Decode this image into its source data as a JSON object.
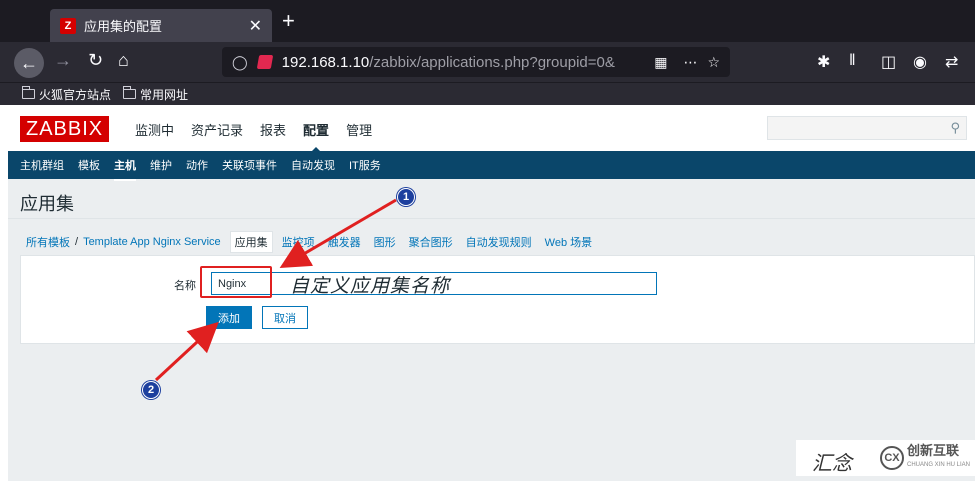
{
  "browser": {
    "tab_favicon": "Z",
    "tab_title": "应用集的配置",
    "tab_close": "✕",
    "new_tab": "+",
    "url_host": "192.168.1.10",
    "url_path": "/zabbix/applications.php?groupid=0&",
    "bookmarks": [
      "火狐官方站点",
      "常用网址"
    ]
  },
  "zabbix": {
    "logo": "ZABBIX",
    "main_menu": [
      {
        "label": "监测中",
        "selected": false
      },
      {
        "label": "资产记录",
        "selected": false
      },
      {
        "label": "报表",
        "selected": false
      },
      {
        "label": "配置",
        "selected": true
      },
      {
        "label": "管理",
        "selected": false
      }
    ],
    "search_placeholder": "",
    "sub_menu": [
      {
        "label": "主机群组",
        "selected": false
      },
      {
        "label": "模板",
        "selected": false
      },
      {
        "label": "主机",
        "selected": true
      },
      {
        "label": "维护",
        "selected": false
      },
      {
        "label": "动作",
        "selected": false
      },
      {
        "label": "关联项事件",
        "selected": false
      },
      {
        "label": "自动发现",
        "selected": false
      },
      {
        "label": "IT服务",
        "selected": false
      }
    ],
    "page_title": "应用集",
    "breadcrumbs": {
      "all_templates": "所有模板",
      "separator": "/",
      "template": "Template App Nginx Service",
      "tabs": [
        "应用集",
        "监控项",
        "触发器",
        "图形",
        "聚合图形",
        "自动发现规则",
        "Web 场景"
      ]
    },
    "form": {
      "name_label": "名称",
      "name_value": "Nginx",
      "add_label": "添加",
      "cancel_label": "取消"
    }
  },
  "annotations": {
    "caption": "自定义应用集名称",
    "marker_1": "1",
    "marker_2": "2"
  },
  "watermark": {
    "left_text": "汇念",
    "brand": "创新互联",
    "logo_glyph": "CX",
    "sub": "CHUANG XIN HU LIAN"
  },
  "colors": {
    "zabbix_red": "#d40000",
    "zabbix_navy": "#0a466a",
    "link_blue": "#0275b8",
    "annotation_red": "#e02020",
    "marker_blue": "#1d3f9e"
  }
}
